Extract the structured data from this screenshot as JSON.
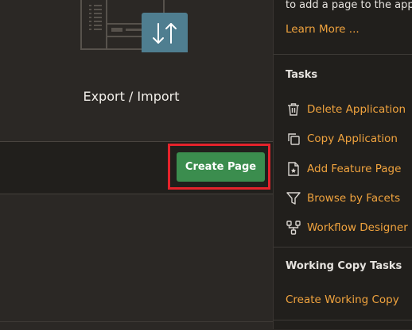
{
  "card": {
    "label": "Export / Import",
    "icon": "swap-vertical-arrows-icon"
  },
  "action_bar": {
    "create_page_label": "Create Page"
  },
  "sidebar": {
    "intro_text": "to add a page to the appl",
    "learn_more": "Learn More ...",
    "tasks_heading": "Tasks",
    "tasks": [
      {
        "label": "Delete Application",
        "icon": "trash-icon"
      },
      {
        "label": "Copy Application",
        "icon": "copy-icon"
      },
      {
        "label": "Add Feature Page",
        "icon": "feature-page-icon"
      },
      {
        "label": "Browse by Facets",
        "icon": "filter-funnel-icon"
      },
      {
        "label": "Workflow Designer",
        "icon": "workflow-icon"
      }
    ],
    "working_copy_heading": "Working Copy Tasks",
    "working_copy_link": "Create Working Copy"
  },
  "colors": {
    "link": "#f0a33e",
    "button": "#3b8d4e",
    "highlight": "#e5232b",
    "tile": "#4f7e90"
  }
}
